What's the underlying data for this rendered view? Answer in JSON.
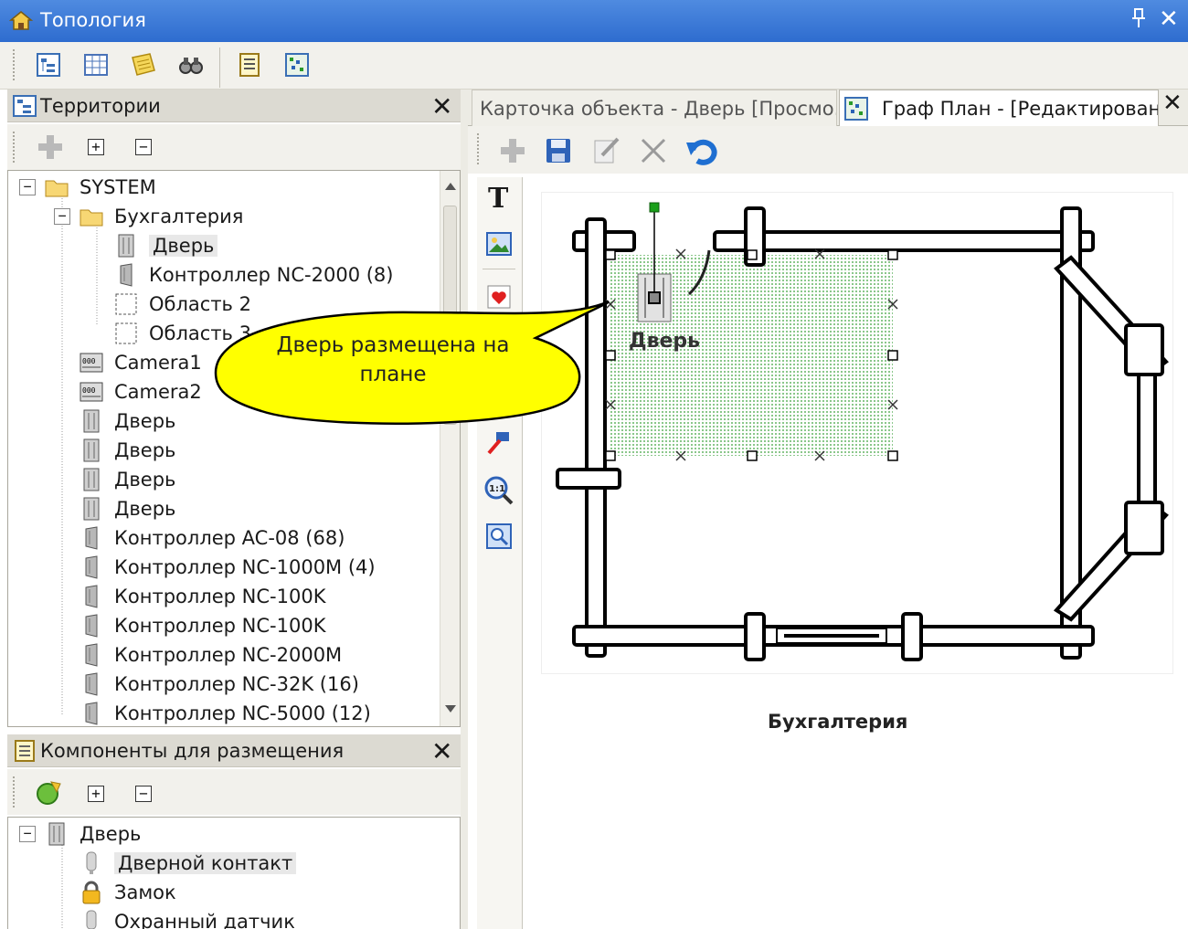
{
  "window": {
    "title": "Топология",
    "pin_glyph": "ᵽ",
    "close_glyph": "✕"
  },
  "main_toolbar": {
    "icons": [
      "tree-view-icon",
      "grid-icon",
      "notes-icon",
      "binoculars-icon",
      "report-icon",
      "graph-plan-icon"
    ]
  },
  "territories_panel": {
    "title": "Территории",
    "close_glyph": "✕",
    "toolbar": {
      "expand": "+",
      "collapse": "−"
    },
    "tree": [
      {
        "label": "SYSTEM",
        "level": 0,
        "icon": "folder-icon",
        "expander": "−"
      },
      {
        "label": "Бухгалтерия",
        "level": 1,
        "icon": "folder-icon",
        "expander": "−"
      },
      {
        "label": "Дверь",
        "level": 2,
        "icon": "door-icon",
        "selected": true
      },
      {
        "label": "Контроллер NC-2000 (8)",
        "level": 2,
        "icon": "controller-icon"
      },
      {
        "label": "Область 2",
        "level": 2,
        "icon": "area-icon"
      },
      {
        "label": "Область 3",
        "level": 2,
        "icon": "area-icon"
      },
      {
        "label": "Camera1",
        "level": 1,
        "icon": "camera-icon"
      },
      {
        "label": "Camera2",
        "level": 1,
        "icon": "camera-icon"
      },
      {
        "label": "Дверь",
        "level": 1,
        "icon": "door-icon"
      },
      {
        "label": "Дверь",
        "level": 1,
        "icon": "door-icon"
      },
      {
        "label": "Дверь",
        "level": 1,
        "icon": "door-icon"
      },
      {
        "label": "Дверь",
        "level": 1,
        "icon": "door-icon"
      },
      {
        "label": "Контроллер AC-08 (68)",
        "level": 1,
        "icon": "controller-icon"
      },
      {
        "label": "Контроллер NC-1000M (4)",
        "level": 1,
        "icon": "controller-icon"
      },
      {
        "label": "Контроллер NC-100K",
        "level": 1,
        "icon": "controller-icon"
      },
      {
        "label": "Контроллер NC-100K",
        "level": 1,
        "icon": "controller-icon"
      },
      {
        "label": "Контроллер NC-2000M",
        "level": 1,
        "icon": "controller-icon"
      },
      {
        "label": "Контроллер NC-32K (16)",
        "level": 1,
        "icon": "controller-icon"
      },
      {
        "label": "Контроллер NC-5000 (12)",
        "level": 1,
        "icon": "controller-icon"
      }
    ]
  },
  "components_panel": {
    "title": "Компоненты для размещения",
    "close_glyph": "✕",
    "toolbar": {
      "expand": "+",
      "collapse": "−"
    },
    "tree": [
      {
        "label": "Дверь",
        "level": 0,
        "icon": "door-icon",
        "expander": "−"
      },
      {
        "label": "Дверной контакт",
        "level": 1,
        "icon": "sensor-icon",
        "selected": true
      },
      {
        "label": "Замок",
        "level": 1,
        "icon": "lock-icon"
      },
      {
        "label": "Охранный датчик",
        "level": 1,
        "icon": "sensor-icon"
      }
    ]
  },
  "tabs": [
    {
      "label": "Карточка объекта - Дверь [Просмо...",
      "active": false
    },
    {
      "label": "Граф План -  [Редактировани",
      "active": true
    }
  ],
  "tab_close_glyph": "✕",
  "doc_toolbar": {
    "icons": [
      "add-icon",
      "save-icon",
      "edit-icon",
      "delete-icon",
      "undo-icon"
    ]
  },
  "side_toolbar": {
    "text_tool": "T",
    "zoom_label": "1:1"
  },
  "plan": {
    "caption": "Бухгалтерия",
    "door_label": "Дверь",
    "callout": "Дверь размещена на плане",
    "colors": {
      "selection_fill": "#b9dcb9",
      "handle": "#ffffff",
      "rotate_handle": "#1aa01a",
      "callout": "#ffff00"
    }
  }
}
